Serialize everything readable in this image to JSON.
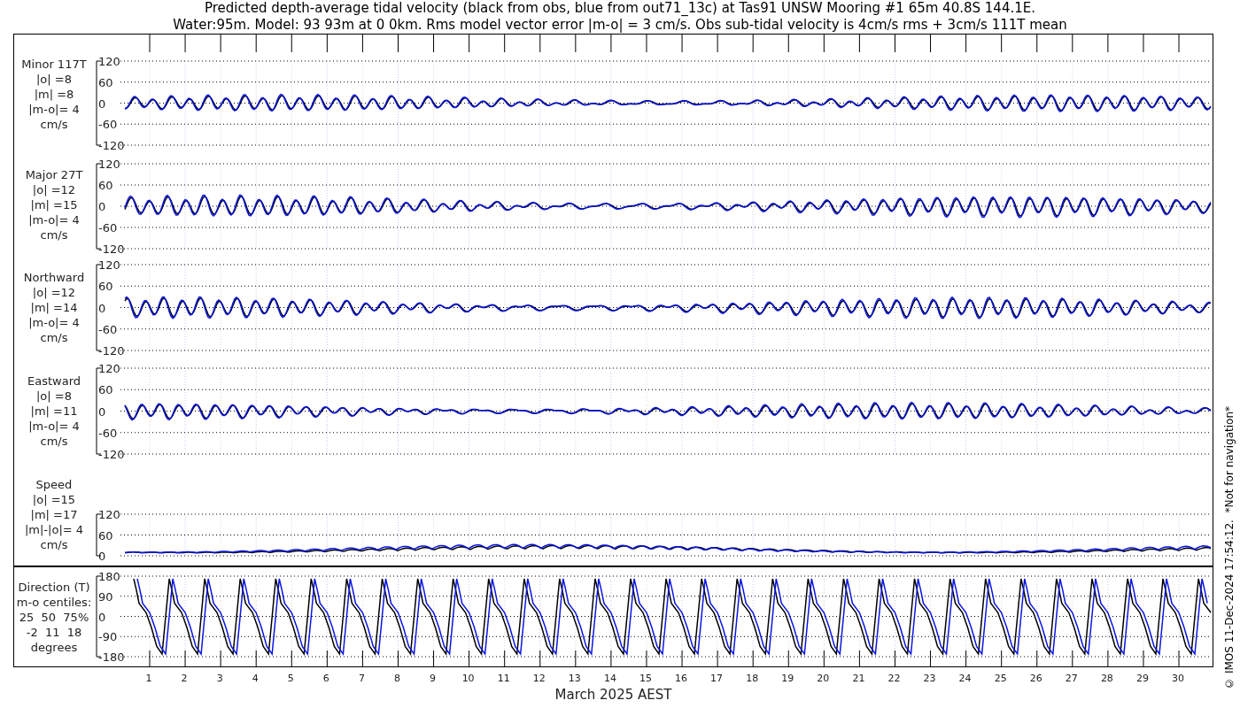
{
  "title_lines": [
    "Predicted depth-average tidal velocity (black from obs, blue from out71_13c) at Tas91 UNSW Mooring #1 65m 40.8S 144.1E.",
    "Water:95m. Model: 93 93m at 0 0km. Rms model vector error |m-o| = 3 cm/s. Obs sub-tidal velocity is 4cm/s rms + 3cm/s 111T mean"
  ],
  "panels": [
    {
      "kind": "signed",
      "label_lines": [
        "Minor 117T",
        "|o| =8",
        "|m| =8",
        "|m-o|= 4",
        "cm/s"
      ],
      "yticks": [
        "120",
        "60",
        "0",
        "-60",
        "-120"
      ]
    },
    {
      "kind": "signed",
      "label_lines": [
        "Major 27T",
        "|o| =12",
        "|m| =15",
        "|m-o|= 4",
        "cm/s"
      ],
      "yticks": [
        "120",
        "60",
        "0",
        "-60",
        "-120"
      ]
    },
    {
      "kind": "signed",
      "label_lines": [
        "Northward",
        "|o| =12",
        "|m| =14",
        "|m-o|= 4",
        "cm/s"
      ],
      "yticks": [
        "120",
        "60",
        "0",
        "-60",
        "-120"
      ]
    },
    {
      "kind": "signed",
      "label_lines": [
        "Eastward",
        "|o| =8",
        "|m| =11",
        "|m-o|= 4",
        "cm/s"
      ],
      "yticks": [
        "120",
        "60",
        "0",
        "-60",
        "-120"
      ]
    },
    {
      "kind": "speed",
      "label_lines": [
        "Speed",
        "|o| =15",
        "|m| =17",
        "|m|-|o|= 4",
        "cm/s"
      ],
      "yticks": [
        "120",
        "60",
        "0"
      ]
    },
    {
      "kind": "direction",
      "label_lines": [
        "Direction (T)",
        "m-o centiles:",
        "25  50  75%",
        "-2  11  18",
        "degrees"
      ],
      "yticks": [
        "180",
        "90",
        "0",
        "-90",
        "-180"
      ]
    }
  ],
  "days": [
    "1",
    "2",
    "3",
    "4",
    "5",
    "6",
    "7",
    "8",
    "9",
    "10",
    "11",
    "12",
    "13",
    "14",
    "15",
    "16",
    "17",
    "18",
    "19",
    "20",
    "21",
    "22",
    "23",
    "24",
    "25",
    "26",
    "27",
    "28",
    "29",
    "30"
  ],
  "xlabel": "March 2025 AEST",
  "side_note": "© IMOS 11-Dec-2024 17:54:12.  *Not for navigation*"
}
